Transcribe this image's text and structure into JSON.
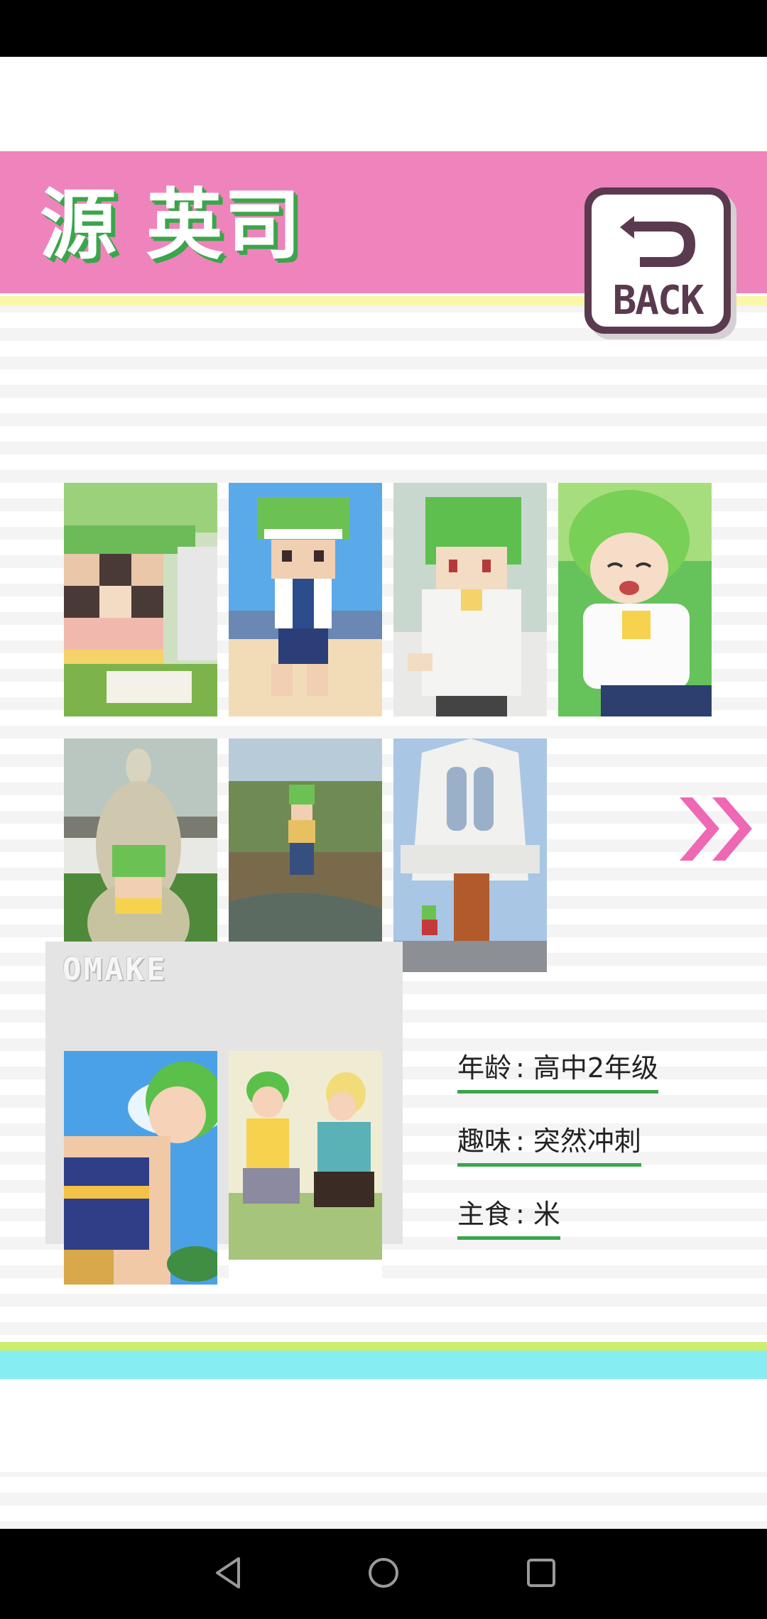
{
  "character": {
    "name": "源 英司"
  },
  "back_button": {
    "label": "BACK",
    "icon": "return-arrow-icon"
  },
  "gallery": {
    "items": [
      {
        "name": "gallery-image-1",
        "desc_icon": "pixel-closeup"
      },
      {
        "name": "gallery-image-2",
        "desc_icon": "pixel-running"
      },
      {
        "name": "gallery-image-3",
        "desc_icon": "pixel-portrait"
      },
      {
        "name": "gallery-image-4",
        "desc_icon": "anime-smiling"
      },
      {
        "name": "gallery-image-5",
        "desc_icon": "kangaroo-statue"
      },
      {
        "name": "gallery-image-6",
        "desc_icon": "stream-photo"
      },
      {
        "name": "gallery-image-7",
        "desc_icon": "church-photo"
      }
    ],
    "next_icon": "double-chevron-right-icon"
  },
  "omake": {
    "title": "OMAKE",
    "items": [
      {
        "name": "omake-image-1"
      },
      {
        "name": "omake-image-2"
      }
    ]
  },
  "profile": {
    "age_label": "年龄",
    "age_value": "高中2年级",
    "hobby_label": "趣味",
    "hobby_value": "突然冲刺",
    "food_label": "主食",
    "food_value": "米",
    "separator": ":"
  },
  "colors": {
    "header_pink": "#ee84bb",
    "accent_green": "#3aa64a",
    "arrow_pink": "#ee68b4",
    "bottom_cyan": "#86eef2",
    "bottom_green": "#cdee6a"
  },
  "system_nav": {
    "back_icon": "triangle-back-icon",
    "home_icon": "circle-home-icon",
    "recents_icon": "square-recents-icon"
  }
}
